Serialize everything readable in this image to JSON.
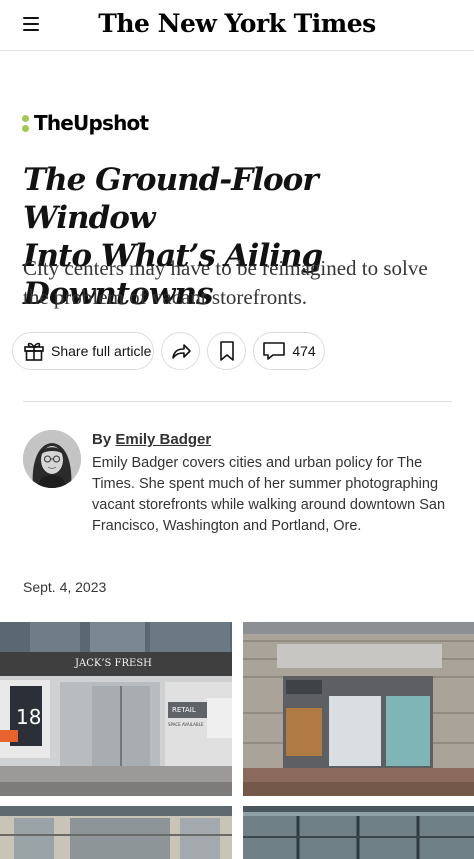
{
  "header": {
    "logo": "The New York Times",
    "menu_icon": "hamburger-menu-icon"
  },
  "section": {
    "label": "TheUpshot",
    "accent_color": "#a1c84f"
  },
  "article": {
    "headline_line1": "The Ground-Floor Window",
    "headline_line2": "Into What’s Ailing Downtowns",
    "summary": "City centers may have to be reimagined to solve the problem of vacant storefronts."
  },
  "actions": {
    "share_label": "Share full article",
    "share_icon": "gift-icon",
    "forward_icon": "share-arrow-icon",
    "save_icon": "bookmark-icon",
    "comments_icon": "comment-icon",
    "comments_count": "474"
  },
  "author": {
    "by": "By",
    "name": "Emily Badger",
    "bio": "Emily Badger covers cities and urban policy for The Times. She spent much of her summer photographing vacant storefronts while walking around downtown San Francisco, Washington and Portland, Ore."
  },
  "date": "Sept. 4, 2023",
  "photos": {
    "sign_jacks": "JACK’S FRESH",
    "sign_retail": "RETAIL",
    "sign_space": "SPACE AVAILABLE",
    "sign_18": "18"
  }
}
